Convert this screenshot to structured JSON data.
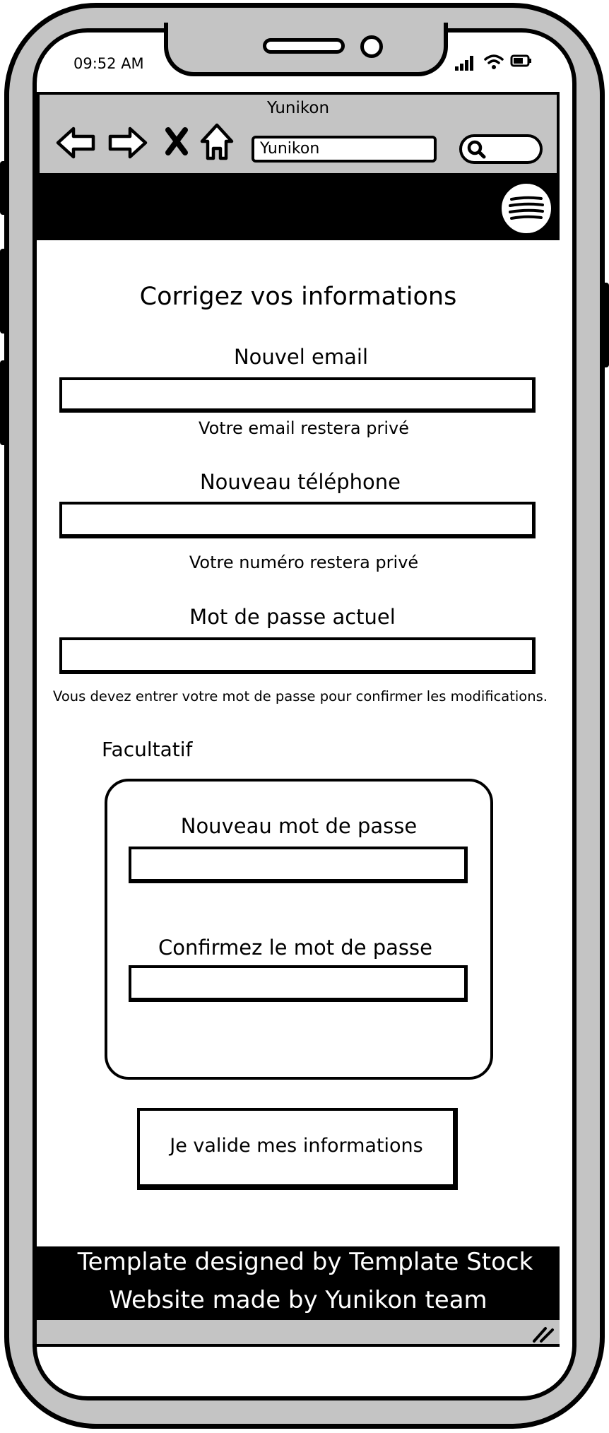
{
  "status_bar": {
    "time": "09:52 AM"
  },
  "browser": {
    "title": "Yunikon",
    "url": "Yunikon",
    "icons": [
      "back-arrow-icon",
      "forward-arrow-icon",
      "close-icon",
      "home-icon",
      "search-icon"
    ]
  },
  "header": {
    "menu_icon": "hamburger-menu-icon"
  },
  "form": {
    "title": "Corrigez vos informations",
    "email": {
      "label": "Nouvel email",
      "value": "",
      "hint": "Votre email restera privé"
    },
    "phone": {
      "label": "Nouveau téléphone",
      "value": "",
      "hint": "Votre numéro restera privé"
    },
    "current_password": {
      "label": "Mot de passe actuel",
      "value": "",
      "hint": "Vous devez entrer votre mot de passe pour confirmer les modifications."
    },
    "optional": {
      "label": "Facultatif",
      "new_password": {
        "label": "Nouveau mot de passe",
        "value": ""
      },
      "confirm_password": {
        "label": "Confirmez le mot de passe",
        "value": ""
      }
    },
    "submit_label": "Je valide mes informations"
  },
  "footer": {
    "line1": "Template designed by Template Stock",
    "line2": "Website made by Yunikon team"
  }
}
